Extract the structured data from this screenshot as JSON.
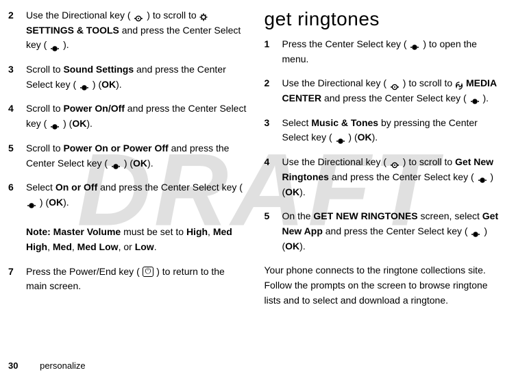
{
  "watermark": "DRAFT",
  "left": {
    "steps": [
      {
        "n": "2",
        "html": "Use the Directional key ({DIR}) to scroll to {GEAR}<span class='ui-bold'>SETTINGS &amp; TOOLS</span> and press the Center Select key ({SEL})."
      },
      {
        "n": "3",
        "html": "Scroll to <span class='ui-bold'>Sound Settings</span> and press the Center Select key ({SEL}) (<span class='ui-bold'>OK</span>)."
      },
      {
        "n": "4",
        "html": "Scroll to <span class='ui-bold'>Power On/Off</span> and press the Center Select key ({SEL}) (<span class='ui-bold'>OK</span>)."
      },
      {
        "n": "5",
        "html": "Scroll to <span class='ui-bold'>Power On or Power Off</span> and press the Center Select key ({SEL}) (<span class='ui-bold'>OK</span>)."
      },
      {
        "n": "6",
        "html": "Select <span class='ui-bold'>On or Off</span> and press the Center Select key ({SEL}) (<span class='ui-bold'>OK</span>).<br><br><span class='note-label'>Note:</span> <span class='ui-bold'>Master Volume</span> must be set to <span class='ui-bold'>High</span>, <span class='ui-bold'>Med High</span>, <span class='ui-bold'>Med</span>, <span class='ui-bold'>Med Low</span>, or <span class='ui-bold'>Low</span>."
      },
      {
        "n": "7",
        "html": "Press the Power/End key ({PWR}) to return to the main screen."
      }
    ]
  },
  "right": {
    "heading": "get ringtones",
    "steps": [
      {
        "n": "1",
        "html": "Press the Center Select key ({SEL}) to open the menu."
      },
      {
        "n": "2",
        "html": "Use the Directional key ({DIR}) to scroll to {MEDIA}<span class='ui-bold'>MEDIA CENTER</span> and press the Center Select key ({SEL})."
      },
      {
        "n": "3",
        "html": "Select <span class='ui-bold'>Music &amp; Tones</span> by pressing the Center Select key ({SEL}) (<span class='ui-bold'>OK</span>)."
      },
      {
        "n": "4",
        "html": "Use the Directional key ({DIR}) to scroll to <span class='ui-bold'>Get New Ringtones</span> and press the Center Select key ({SEL}) (<span class='ui-bold'>OK</span>)."
      },
      {
        "n": "5",
        "html": "On the <span class='ui-bold'>GET NEW RINGTONES</span> screen, select <span class='ui-bold'>Get New App</span> and press the Center Select key ({SEL}) (<span class='ui-bold'>OK</span>)."
      }
    ],
    "after": "Your phone connects to the ringtone collections site. Follow the prompts on the screen to browse ringtone lists and to select and download a ringtone."
  },
  "footer": {
    "page": "30",
    "section": "personalize"
  }
}
